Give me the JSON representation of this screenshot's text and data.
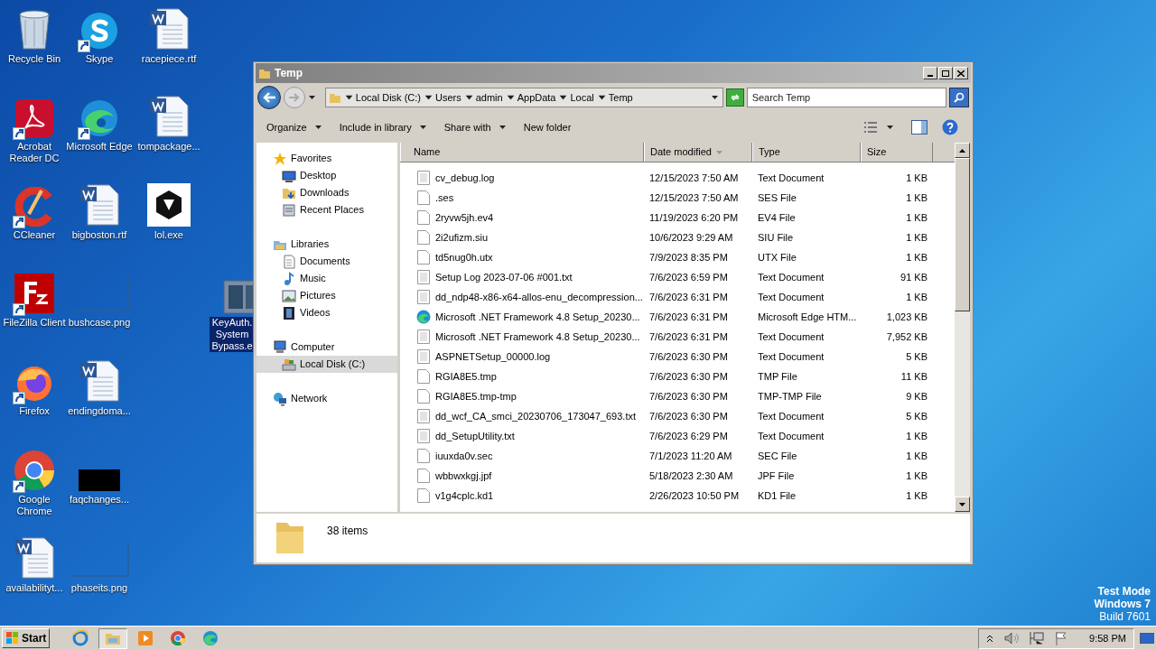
{
  "desktop_icons": [
    {
      "label": "Recycle Bin",
      "kind": "recycle",
      "shortcut": false,
      "selected": false
    },
    {
      "label": "Skype",
      "kind": "skype",
      "shortcut": true,
      "selected": false
    },
    {
      "label": "racepiece.rtf",
      "kind": "word",
      "shortcut": false,
      "selected": false
    },
    {
      "label": "Acrobat Reader DC",
      "kind": "acrobat",
      "shortcut": true,
      "selected": false
    },
    {
      "label": "Microsoft Edge",
      "kind": "edge",
      "shortcut": true,
      "selected": false
    },
    {
      "label": "tompackage...",
      "kind": "word",
      "shortcut": false,
      "selected": false
    },
    {
      "label": "CCleaner",
      "kind": "ccleaner",
      "shortcut": true,
      "selected": false
    },
    {
      "label": "bigboston.rtf",
      "kind": "word",
      "shortcut": false,
      "selected": false
    },
    {
      "label": "lol.exe",
      "kind": "emblem",
      "shortcut": false,
      "selected": false
    },
    {
      "label": "FileZilla Client",
      "kind": "filezilla",
      "shortcut": true,
      "selected": false
    },
    {
      "label": "bushcase.png",
      "kind": "image",
      "shortcut": false,
      "selected": false
    },
    {
      "label": "KeyAuth. System Bypass.e",
      "kind": "app",
      "shortcut": false,
      "selected": true
    },
    {
      "label": "Firefox",
      "kind": "firefox",
      "shortcut": true,
      "selected": false
    },
    {
      "label": "endingdoma...",
      "kind": "word",
      "shortcut": false,
      "selected": false
    },
    {
      "label": "Google Chrome",
      "kind": "chrome",
      "shortcut": true,
      "selected": false
    },
    {
      "label": "faqchanges...",
      "kind": "dark",
      "shortcut": false,
      "selected": false
    },
    {
      "label": "availabilityt...",
      "kind": "word",
      "shortcut": false,
      "selected": false
    },
    {
      "label": "phaseits.png",
      "kind": "image",
      "shortcut": false,
      "selected": false
    }
  ],
  "window": {
    "title": "Temp",
    "breadcrumb": [
      "Local Disk (C:)",
      "Users",
      "admin",
      "AppData",
      "Local",
      "Temp"
    ],
    "search": {
      "placeholder": "Search Temp"
    },
    "toolbar": [
      {
        "label": "Organize",
        "dropdown": true
      },
      {
        "label": "Include in library",
        "dropdown": true
      },
      {
        "label": "Share with",
        "dropdown": true
      },
      {
        "label": "New folder",
        "dropdown": false
      }
    ],
    "nav": [
      {
        "label": "Favorites",
        "kind": "star",
        "selected": false,
        "children": [
          {
            "label": "Desktop",
            "kind": "desktop",
            "selected": false
          },
          {
            "label": "Downloads",
            "kind": "downloads",
            "selected": false
          },
          {
            "label": "Recent Places",
            "kind": "recent",
            "selected": false
          }
        ]
      },
      {
        "label": "Libraries",
        "kind": "libraries",
        "selected": false,
        "children": [
          {
            "label": "Documents",
            "kind": "documents",
            "selected": false
          },
          {
            "label": "Music",
            "kind": "music",
            "selected": false
          },
          {
            "label": "Pictures",
            "kind": "pictures",
            "selected": false
          },
          {
            "label": "Videos",
            "kind": "videos",
            "selected": false
          }
        ]
      },
      {
        "label": "Computer",
        "kind": "computer",
        "selected": false,
        "children": [
          {
            "label": "Local Disk (C:)",
            "kind": "disk",
            "selected": true
          }
        ]
      },
      {
        "label": "Network",
        "kind": "network",
        "selected": false
      }
    ],
    "columns": [
      {
        "label": "Name",
        "sorted": false
      },
      {
        "label": "Date modified",
        "sorted": true
      },
      {
        "label": "Type",
        "sorted": false
      },
      {
        "label": "Size",
        "sorted": false
      }
    ],
    "rows": [
      {
        "name": "cv_debug.log",
        "date": "12/15/2023 7:50 AM",
        "type": "Text Document",
        "size": "1 KB",
        "kind": "text"
      },
      {
        "name": ".ses",
        "date": "12/15/2023 7:50 AM",
        "type": "SES File",
        "size": "1 KB",
        "kind": "blank"
      },
      {
        "name": "2ryvw5jh.ev4",
        "date": "11/19/2023 6:20 PM",
        "type": "EV4 File",
        "size": "1 KB",
        "kind": "blank"
      },
      {
        "name": "2i2ufizm.siu",
        "date": "10/6/2023 9:29 AM",
        "type": "SIU File",
        "size": "1 KB",
        "kind": "blank"
      },
      {
        "name": "td5nug0h.utx",
        "date": "7/9/2023 8:35 PM",
        "type": "UTX File",
        "size": "1 KB",
        "kind": "blank"
      },
      {
        "name": "Setup Log 2023-07-06 #001.txt",
        "date": "7/6/2023 6:59 PM",
        "type": "Text Document",
        "size": "91 KB",
        "kind": "text"
      },
      {
        "name": "dd_ndp48-x86-x64-allos-enu_decompression...",
        "date": "7/6/2023 6:31 PM",
        "type": "Text Document",
        "size": "1 KB",
        "kind": "text"
      },
      {
        "name": "Microsoft .NET Framework 4.8 Setup_20230...",
        "date": "7/6/2023 6:31 PM",
        "type": "Microsoft Edge HTM...",
        "size": "1,023 KB",
        "kind": "edge"
      },
      {
        "name": "Microsoft .NET Framework 4.8 Setup_20230...",
        "date": "7/6/2023 6:31 PM",
        "type": "Text Document",
        "size": "7,952 KB",
        "kind": "text"
      },
      {
        "name": "ASPNETSetup_00000.log",
        "date": "7/6/2023 6:30 PM",
        "type": "Text Document",
        "size": "5 KB",
        "kind": "text"
      },
      {
        "name": "RGIA8E5.tmp",
        "date": "7/6/2023 6:30 PM",
        "type": "TMP File",
        "size": "11 KB",
        "kind": "blank"
      },
      {
        "name": "RGIA8E5.tmp-tmp",
        "date": "7/6/2023 6:30 PM",
        "type": "TMP-TMP File",
        "size": "9 KB",
        "kind": "blank"
      },
      {
        "name": "dd_wcf_CA_smci_20230706_173047_693.txt",
        "date": "7/6/2023 6:30 PM",
        "type": "Text Document",
        "size": "5 KB",
        "kind": "text"
      },
      {
        "name": "dd_SetupUtility.txt",
        "date": "7/6/2023 6:29 PM",
        "type": "Text Document",
        "size": "1 KB",
        "kind": "text"
      },
      {
        "name": "iuuxda0v.sec",
        "date": "7/1/2023 11:20 AM",
        "type": "SEC File",
        "size": "1 KB",
        "kind": "blank"
      },
      {
        "name": "wbbwxkgj.jpf",
        "date": "5/18/2023 2:30 AM",
        "type": "JPF File",
        "size": "1 KB",
        "kind": "blank"
      },
      {
        "name": "v1g4cplc.kd1",
        "date": "2/26/2023 10:50 PM",
        "type": "KD1 File",
        "size": "1 KB",
        "kind": "blank"
      }
    ],
    "status": "38 items"
  },
  "desktop_notice": [
    "Test Mode",
    "Windows 7",
    "Build 7601"
  ],
  "taskbar": {
    "start": "Start",
    "apps": [
      {
        "kind": "ie",
        "active": false
      },
      {
        "kind": "explorer",
        "active": true
      },
      {
        "kind": "media",
        "active": false
      },
      {
        "kind": "chrome",
        "active": false
      },
      {
        "kind": "edge",
        "active": false
      }
    ],
    "clock": "9:58 PM"
  }
}
